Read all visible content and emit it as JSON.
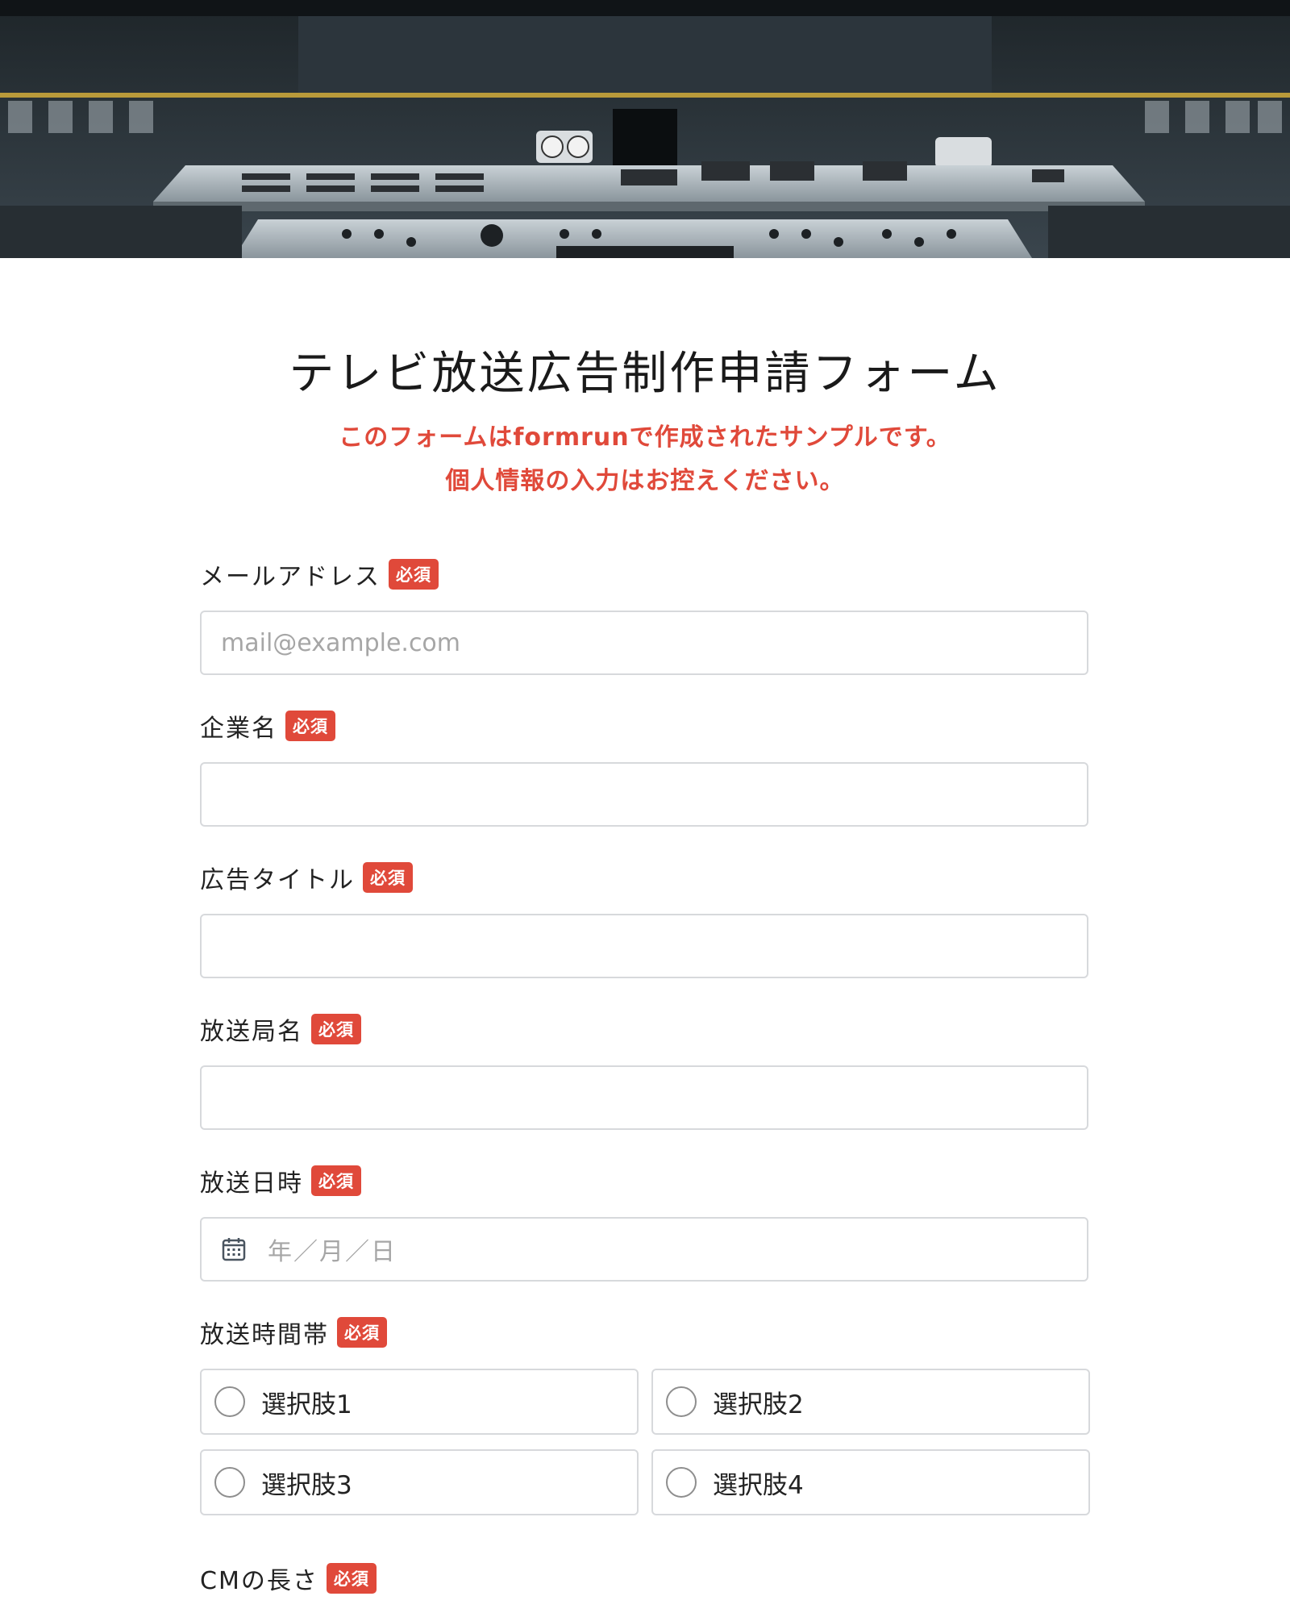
{
  "form": {
    "title": "テレビ放送広告制作申請フォーム",
    "notice_line1": "このフォームはformrunで作成されたサンプルです。",
    "notice_line2": "個人情報の入力はお控えください。",
    "required_label": "必須"
  },
  "fields": {
    "email": {
      "label": "メールアドレス",
      "placeholder": "mail@example.com",
      "value": ""
    },
    "company": {
      "label": "企業名",
      "value": ""
    },
    "ad_title": {
      "label": "広告タイトル",
      "value": ""
    },
    "station": {
      "label": "放送局名",
      "value": ""
    },
    "date": {
      "label": "放送日時",
      "placeholder": "年／月／日"
    },
    "timeslot": {
      "label": "放送時間帯",
      "options": [
        "選択肢1",
        "選択肢2",
        "選択肢3",
        "選択肢4"
      ]
    },
    "cm_length": {
      "label": "CMの長さ"
    }
  },
  "icons": {
    "date": "calendar-icon",
    "radio": "radio-unchecked-icon"
  },
  "colors": {
    "accent": "#e0493a",
    "border": "#d7d9dc",
    "placeholder": "#a6a6a6"
  }
}
